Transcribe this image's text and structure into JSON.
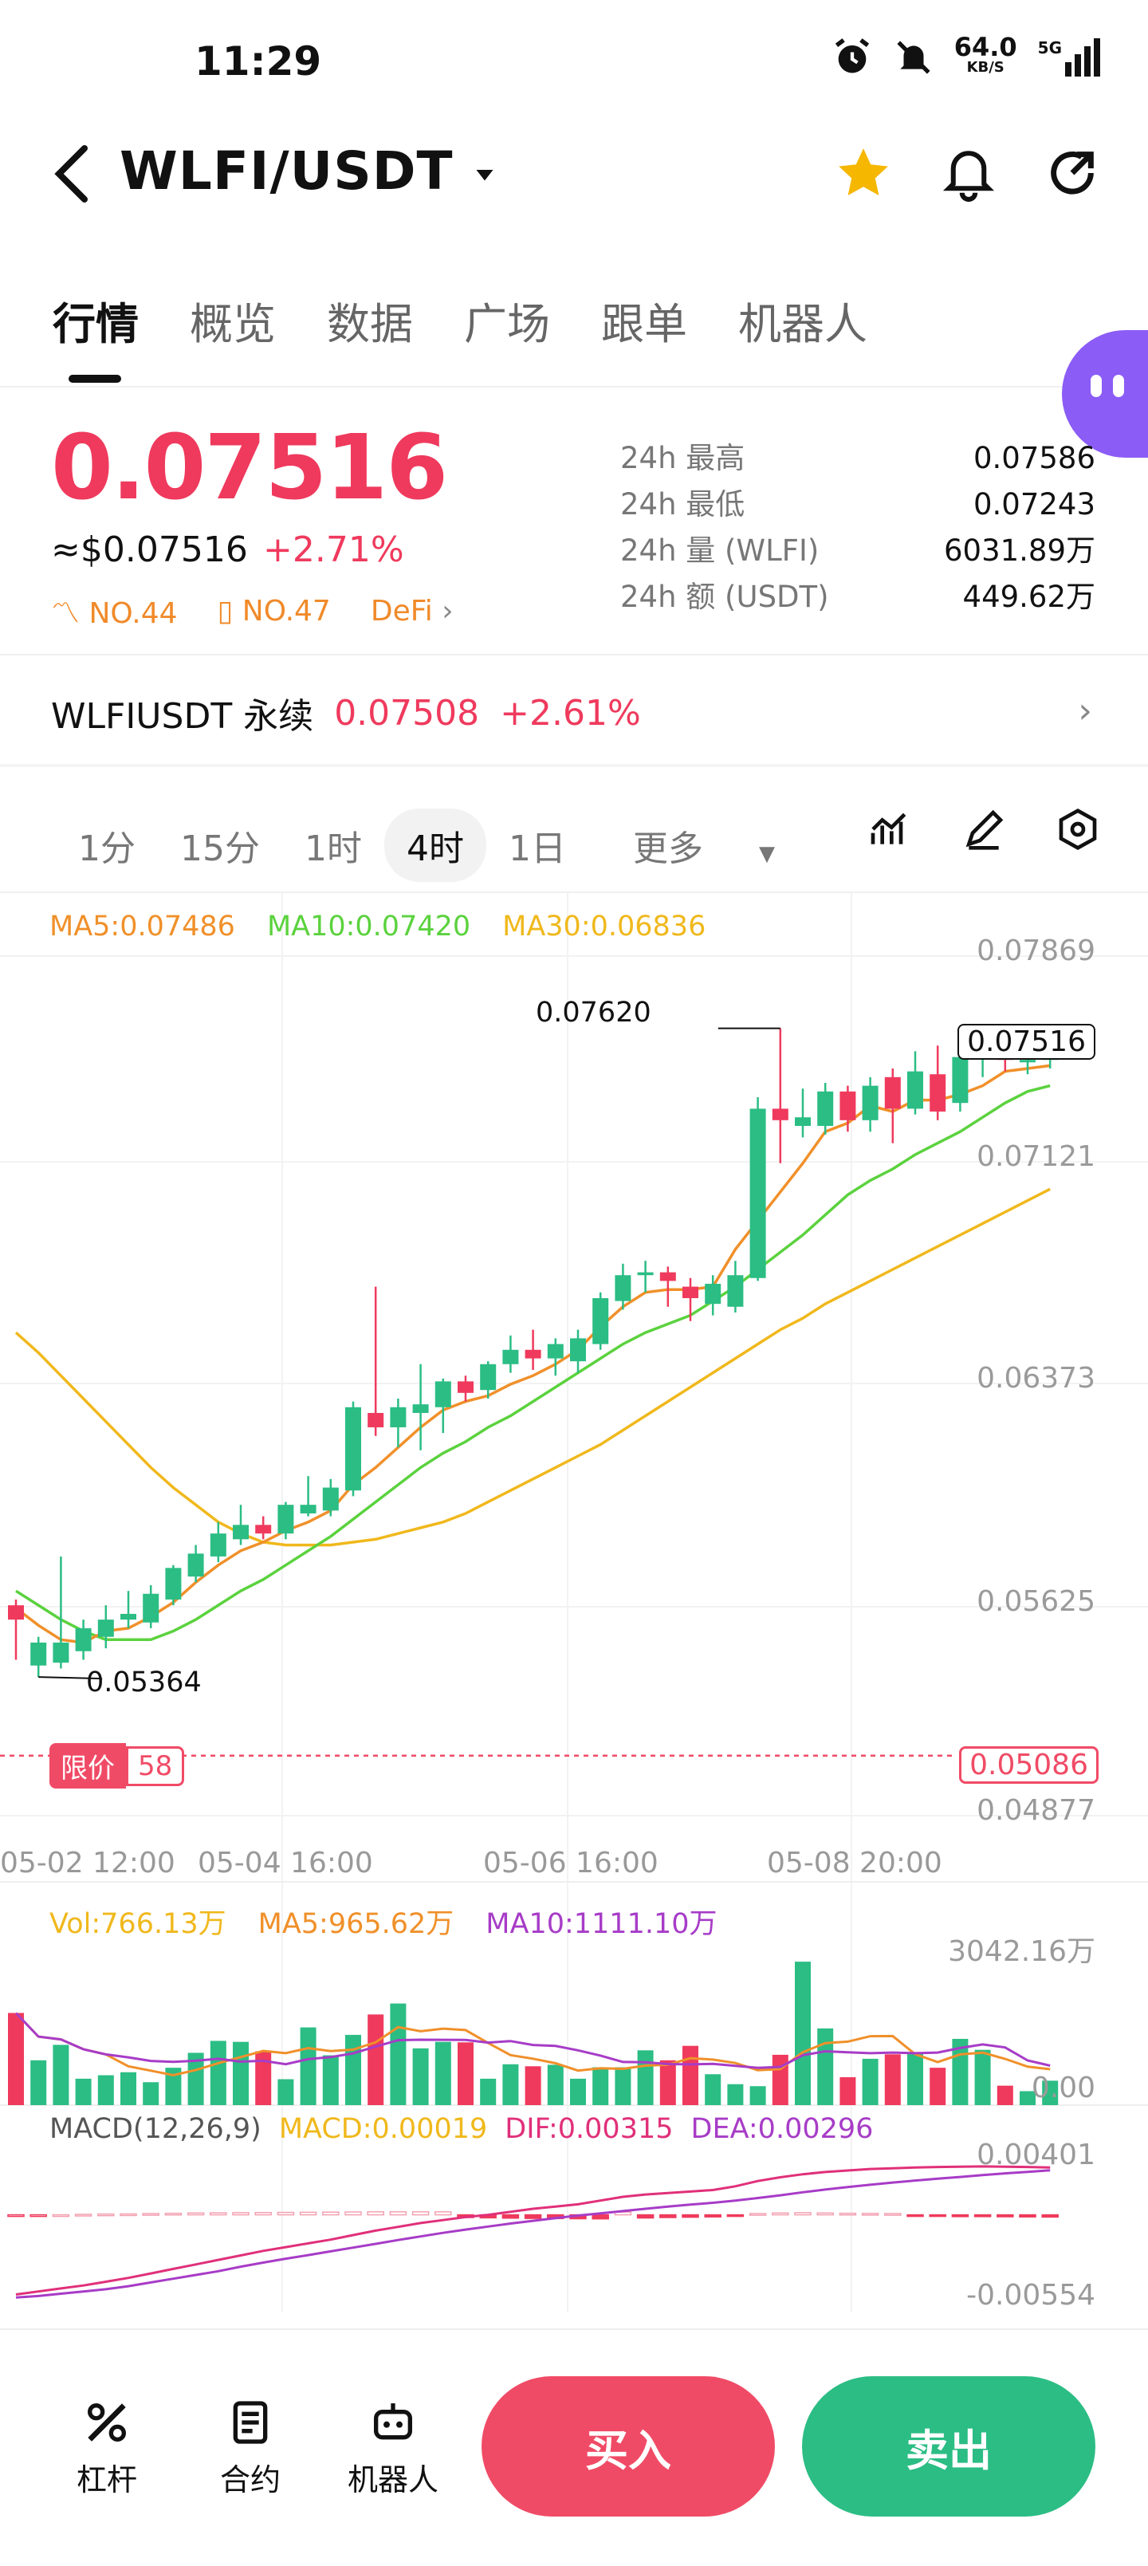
{
  "status_bar": {
    "time": "11:29",
    "net_speed": "64.0",
    "net_unit": "KB/S",
    "signal": "5G"
  },
  "header": {
    "pair": "WLFI/USDT",
    "icons": [
      "back-icon",
      "dropdown-icon",
      "star-icon",
      "bell-icon",
      "share-icon"
    ]
  },
  "tabs": [
    "行情",
    "概览",
    "数据",
    "广场",
    "跟单",
    "机器人"
  ],
  "price": {
    "last": "0.07516",
    "usd": "≈$0.07516",
    "change": "+2.71%",
    "tags": [
      "NO.44",
      "NO.47",
      "DeFi"
    ]
  },
  "stats": [
    {
      "label": "24h  最高",
      "value": "0.07586"
    },
    {
      "label": "24h  最低",
      "value": "0.07243"
    },
    {
      "label": "24h  量 (WLFI)",
      "value": "6031.89万"
    },
    {
      "label": "24h  额 (USDT)",
      "value": "449.62万"
    }
  ],
  "perp": {
    "name": "WLFIUSDT 永续",
    "price": "0.07508",
    "change": "+2.61%"
  },
  "timeframes": [
    "1分",
    "15分",
    "1时",
    "4时",
    "1日",
    "更多"
  ],
  "selected_timeframe": "4时",
  "indicators": {
    "ma5": "MA5:0.07486",
    "ma10": "MA10:0.07420",
    "ma30": "MA30:0.06836",
    "vol": "Vol:766.13万",
    "vol_ma5": "MA5:965.62万",
    "vol_ma10": "MA10:1111.10万",
    "macd_title": "MACD(12,26,9)",
    "macd": "MACD:0.00019",
    "dif": "DIF:0.00315",
    "dea": "DEA:0.00296"
  },
  "chart_labels": {
    "high": "0.07620",
    "low": "0.05364",
    "current": "0.07516",
    "limit_label": "限价",
    "limit_count": "58",
    "limit_price": "0.05086",
    "vol_top": "3042.16万",
    "vol_bottom": "0.00",
    "macd_top": "0.00401",
    "macd_bottom": "-0.00554"
  },
  "colors": {
    "up": "#2bbd84",
    "down": "#ef3a5d",
    "ma5": "#f0902a",
    "ma10": "#5bd23e",
    "ma30": "#f0b81c"
  },
  "chart_data": {
    "type": "candlestick",
    "y_ticks": [
      "0.07869",
      "0.07121",
      "0.06373",
      "0.05625",
      "0.04877"
    ],
    "x_ticks": [
      "05-02 12:00",
      "05-04 16:00",
      "05-06 16:00",
      "05-08 20:00"
    ],
    "candles": [
      {
        "o": 0.0561,
        "c": 0.0556,
        "h": 0.0563,
        "l": 0.0542
      },
      {
        "o": 0.054,
        "c": 0.0548,
        "h": 0.055,
        "l": 0.0536
      },
      {
        "o": 0.0541,
        "c": 0.0548,
        "h": 0.0578,
        "l": 0.0539
      },
      {
        "o": 0.0545,
        "c": 0.0553,
        "h": 0.0556,
        "l": 0.0542
      },
      {
        "o": 0.055,
        "c": 0.0556,
        "h": 0.0561,
        "l": 0.0546
      },
      {
        "o": 0.0556,
        "c": 0.0558,
        "h": 0.0566,
        "l": 0.0553
      },
      {
        "o": 0.0555,
        "c": 0.0565,
        "h": 0.0568,
        "l": 0.0553
      },
      {
        "o": 0.0563,
        "c": 0.0574,
        "h": 0.0575,
        "l": 0.0561
      },
      {
        "o": 0.0571,
        "c": 0.0579,
        "h": 0.0582,
        "l": 0.0569
      },
      {
        "o": 0.0578,
        "c": 0.0586,
        "h": 0.059,
        "l": 0.0576
      },
      {
        "o": 0.0584,
        "c": 0.0589,
        "h": 0.0596,
        "l": 0.0582
      },
      {
        "o": 0.0589,
        "c": 0.0586,
        "h": 0.0592,
        "l": 0.0584
      },
      {
        "o": 0.0586,
        "c": 0.0596,
        "h": 0.0597,
        "l": 0.0584
      },
      {
        "o": 0.0593,
        "c": 0.0596,
        "h": 0.0606,
        "l": 0.0592
      },
      {
        "o": 0.0594,
        "c": 0.0602,
        "h": 0.0605,
        "l": 0.0592
      },
      {
        "o": 0.0601,
        "c": 0.063,
        "h": 0.0632,
        "l": 0.0599
      },
      {
        "o": 0.0628,
        "c": 0.0623,
        "h": 0.0672,
        "l": 0.062
      },
      {
        "o": 0.0623,
        "c": 0.063,
        "h": 0.0633,
        "l": 0.0616
      },
      {
        "o": 0.0628,
        "c": 0.0631,
        "h": 0.0645,
        "l": 0.0615
      },
      {
        "o": 0.063,
        "c": 0.0639,
        "h": 0.064,
        "l": 0.0621
      },
      {
        "o": 0.0639,
        "c": 0.0635,
        "h": 0.0641,
        "l": 0.0632
      },
      {
        "o": 0.0636,
        "c": 0.0645,
        "h": 0.0646,
        "l": 0.0633
      },
      {
        "o": 0.0645,
        "c": 0.065,
        "h": 0.0655,
        "l": 0.0642
      },
      {
        "o": 0.065,
        "c": 0.0647,
        "h": 0.0657,
        "l": 0.0643
      },
      {
        "o": 0.0647,
        "c": 0.0652,
        "h": 0.0654,
        "l": 0.0641
      },
      {
        "o": 0.0646,
        "c": 0.0654,
        "h": 0.0657,
        "l": 0.0642
      },
      {
        "o": 0.0652,
        "c": 0.0668,
        "h": 0.067,
        "l": 0.065
      },
      {
        "o": 0.0667,
        "c": 0.0676,
        "h": 0.068,
        "l": 0.0664
      },
      {
        "o": 0.0676,
        "c": 0.0677,
        "h": 0.0681,
        "l": 0.067
      },
      {
        "o": 0.0677,
        "c": 0.0674,
        "h": 0.0679,
        "l": 0.0665
      },
      {
        "o": 0.0672,
        "c": 0.0668,
        "h": 0.0675,
        "l": 0.066
      },
      {
        "o": 0.0666,
        "c": 0.0673,
        "h": 0.0676,
        "l": 0.0662
      },
      {
        "o": 0.0665,
        "c": 0.0676,
        "h": 0.0681,
        "l": 0.0663
      },
      {
        "o": 0.0675,
        "c": 0.0734,
        "h": 0.0738,
        "l": 0.0674
      },
      {
        "o": 0.0734,
        "c": 0.073,
        "h": 0.0762,
        "l": 0.0715
      },
      {
        "o": 0.0728,
        "c": 0.0731,
        "h": 0.0741,
        "l": 0.0724
      },
      {
        "o": 0.0728,
        "c": 0.074,
        "h": 0.0743,
        "l": 0.0725
      },
      {
        "o": 0.074,
        "c": 0.073,
        "h": 0.0742,
        "l": 0.0726
      },
      {
        "o": 0.073,
        "c": 0.0742,
        "h": 0.0745,
        "l": 0.0726
      },
      {
        "o": 0.0745,
        "c": 0.0734,
        "h": 0.0748,
        "l": 0.0722
      },
      {
        "o": 0.0734,
        "c": 0.0747,
        "h": 0.0754,
        "l": 0.0732
      },
      {
        "o": 0.0746,
        "c": 0.0733,
        "h": 0.0756,
        "l": 0.073
      },
      {
        "o": 0.0736,
        "c": 0.0752,
        "h": 0.0756,
        "l": 0.0733
      },
      {
        "o": 0.0752,
        "c": 0.0752,
        "h": 0.0757,
        "l": 0.0745
      },
      {
        "o": 0.0752,
        "c": 0.0751,
        "h": 0.0756,
        "l": 0.0747
      },
      {
        "o": 0.0751,
        "c": 0.0751,
        "h": 0.0759,
        "l": 0.0746
      },
      {
        "o": 0.0751,
        "c": 0.0752,
        "h": 0.0757,
        "l": 0.0748
      }
    ],
    "ma5": [
      0.056,
      0.0554,
      0.0549,
      0.0548,
      0.0552,
      0.0553,
      0.0557,
      0.0562,
      0.0569,
      0.0575,
      0.058,
      0.0583,
      0.0587,
      0.059,
      0.0594,
      0.0603,
      0.0609,
      0.0616,
      0.0623,
      0.0629,
      0.0632,
      0.0634,
      0.0638,
      0.0641,
      0.0645,
      0.065,
      0.0658,
      0.0665,
      0.067,
      0.0671,
      0.0671,
      0.0672,
      0.0685,
      0.0695,
      0.0705,
      0.0715,
      0.0726,
      0.0729,
      0.0735,
      0.0733,
      0.0737,
      0.0737,
      0.0739,
      0.0742,
      0.0747,
      0.0748,
      0.0749
    ],
    "ma10": [
      0.0566,
      0.0561,
      0.0556,
      0.0552,
      0.0549,
      0.0549,
      0.0549,
      0.0552,
      0.0556,
      0.0561,
      0.0566,
      0.057,
      0.0575,
      0.058,
      0.0585,
      0.0591,
      0.0597,
      0.0603,
      0.0609,
      0.0614,
      0.0618,
      0.0623,
      0.0627,
      0.0632,
      0.0637,
      0.0642,
      0.0647,
      0.0652,
      0.0656,
      0.0659,
      0.0662,
      0.0667,
      0.0672,
      0.0678,
      0.0684,
      0.069,
      0.0697,
      0.0704,
      0.0709,
      0.0713,
      0.0718,
      0.0722,
      0.0726,
      0.0731,
      0.0736,
      0.074,
      0.0742
    ],
    "ma30": [
      0.0656,
      0.0649,
      0.0641,
      0.0633,
      0.0625,
      0.0617,
      0.0609,
      0.0602,
      0.0596,
      0.059,
      0.0586,
      0.0583,
      0.0582,
      0.0582,
      0.0582,
      0.0583,
      0.0584,
      0.0586,
      0.0588,
      0.059,
      0.0593,
      0.0597,
      0.0601,
      0.0605,
      0.0609,
      0.0613,
      0.0617,
      0.0622,
      0.0627,
      0.0632,
      0.0637,
      0.0642,
      0.0647,
      0.0652,
      0.0657,
      0.0661,
      0.0666,
      0.067,
      0.0674,
      0.0678,
      0.0682,
      0.0686,
      0.069,
      0.0694,
      0.0698,
      0.0702,
      0.0706
    ],
    "volume": [
      1850,
      900,
      1210,
      530,
      600,
      660,
      460,
      750,
      1050,
      1290,
      1270,
      1080,
      520,
      1560,
      1000,
      1410,
      1820,
      2040,
      1140,
      1270,
      1260,
      530,
      820,
      780,
      810,
      530,
      760,
      760,
      1100,
      900,
      1190,
      620,
      420,
      380,
      1010,
      2880,
      1540,
      560,
      930,
      1020,
      1060,
      750,
      1330,
      1110,
      390,
      280,
      490
    ],
    "macd_hist": [
      -3e-05,
      -1e-05,
      0.0,
      3e-05,
      5e-05,
      6e-05,
      8e-05,
      0.0001,
      0.00012,
      0.00013,
      0.00014,
      0.00015,
      0.00016,
      0.00017,
      0.00018,
      0.00019,
      0.0002,
      0.0002,
      0.0002,
      0.0002,
      -0.00018,
      -0.0002,
      -0.00022,
      -0.00024,
      -0.00025,
      -0.00026,
      -0.00027,
      0.00018,
      -0.00021,
      -0.00018,
      -0.00016,
      -0.00014,
      -0.0001,
      8e-05,
      0.00012,
      0.00014,
      0.00012,
      0.0001,
      9e-05,
      8e-05,
      -8e-05,
      -0.0001,
      -0.00012,
      -0.00012,
      -0.00013,
      -0.00014,
      -0.00015
    ],
    "dif": [
      -0.0053,
      -0.0051,
      -0.0049,
      -0.0047,
      -0.00445,
      -0.0042,
      -0.0039,
      -0.0036,
      -0.0033,
      -0.003,
      -0.0027,
      -0.0024,
      -0.00215,
      -0.0019,
      -0.00165,
      -0.00135,
      -0.00105,
      -0.0008,
      -0.00055,
      -0.00035,
      -0.00015,
      0.0,
      0.0002,
      0.0004,
      0.00055,
      0.0007,
      0.00095,
      0.0012,
      0.00135,
      0.00145,
      0.00155,
      0.00165,
      0.0019,
      0.00225,
      0.0025,
      0.0027,
      0.00285,
      0.00295,
      0.00305,
      0.0031,
      0.00315,
      0.00318,
      0.0032,
      0.00322,
      0.0032,
      0.00318,
      0.00315
    ],
    "dea": [
      -0.0055,
      -0.0054,
      -0.00525,
      -0.0051,
      -0.00495,
      -0.00475,
      -0.0045,
      -0.00425,
      -0.004,
      -0.00375,
      -0.00345,
      -0.00318,
      -0.00292,
      -0.00268,
      -0.00243,
      -0.00218,
      -0.00193,
      -0.00168,
      -0.00144,
      -0.0012,
      -0.00098,
      -0.00078,
      -0.00058,
      -0.0004,
      -0.00022,
      -5e-05,
      0.0001,
      0.00025,
      0.0004,
      0.00055,
      0.00068,
      0.0008,
      0.00095,
      0.00112,
      0.0013,
      0.0015,
      0.00168,
      0.00185,
      0.002,
      0.00215,
      0.00228,
      0.0024,
      0.00252,
      0.00264,
      0.00276,
      0.00286,
      0.00296
    ]
  },
  "bottom_nav": {
    "leverage": "杠杆",
    "contract": "合约",
    "bot": "机器人",
    "buy": "买入",
    "sell": "卖出"
  }
}
